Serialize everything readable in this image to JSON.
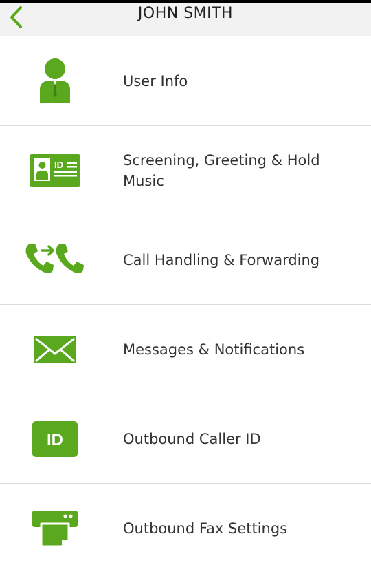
{
  "accent_color": "#5aa81e",
  "header": {
    "title": "JOHN SMITH",
    "back_icon": "chevron-left-icon"
  },
  "menu": {
    "items": [
      {
        "label": "User Info",
        "icon": "user-icon"
      },
      {
        "label": "Screening, Greeting & Hold Music",
        "icon": "id-card-icon"
      },
      {
        "label": "Call Handling & Forwarding",
        "icon": "call-forward-icon"
      },
      {
        "label": "Messages & Notifications",
        "icon": "envelope-icon"
      },
      {
        "label": "Outbound Caller ID",
        "icon": "caller-id-icon",
        "icon_text": "ID"
      },
      {
        "label": "Outbound Fax Settings",
        "icon": "fax-icon"
      }
    ]
  }
}
